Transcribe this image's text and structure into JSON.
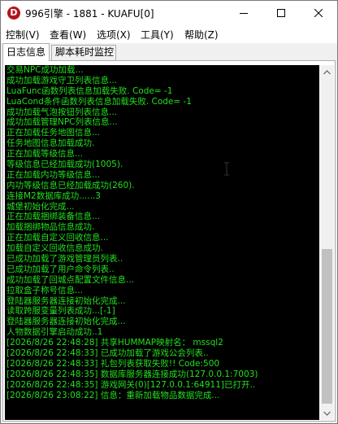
{
  "window": {
    "title": "996引擎 - 1881 - KUAFU[0]",
    "app_icon_glyph": "D",
    "accent_color": "#b3151b"
  },
  "menubar": {
    "items": [
      "控制(V)",
      "查看(W)",
      "选项(X)",
      "工具(Y)",
      "帮助(Z)"
    ]
  },
  "tabs": [
    {
      "label": "日志信息",
      "active": true
    },
    {
      "label": "脚本耗时监控",
      "active": false
    }
  ],
  "log": {
    "text_color": "#22e01e",
    "background_color": "#000000",
    "lines": [
      "交易NPC成功加载...",
      "成功加载游戏守卫列表信息...",
      "LuaFunc函数列表信息加载失败. Code= -1",
      "LuaCond条件函数列表信息加载失败. Code= -1",
      "成功加载气泡按钮列表信息...",
      "成功加载管理NPC列表信息...",
      "正在加载任务地图信息...",
      "任务地图信息加载成功.",
      "正在加载等级信息...",
      "等级信息已经加载成功(1005).",
      "正在加载内功等级信息...",
      "内功等级信息已经加载成功(260).",
      "连接M2数据库成功......3",
      "城堡初始化完成...",
      "正在加载捆绑装备信息...",
      "加载捆绑物品信息成功.",
      "正在加载自定义回收信息...",
      "加载自定义回收信息成功.",
      "已成功加载了游戏管理员列表..",
      "已成功加载了用户命令列表..",
      "成功加载了回城点配置文件信息...",
      "拉取盒子称号信息...",
      "登陆器服务器连接初始化完成...",
      "读取跨服变量列表成功...[-1]",
      "登陆器服务器连接初始化完成...",
      "人物数据引擎启动成功..1",
      "[2026/8/26 22:48:28] 共享HUMMAP映射名： mssql2",
      "[2026/8/26 22:48:33] 已成功加载了游戏公会列表..",
      "[2026/8/26 22:48:33] 礼包列表获取失败!! Code:500",
      "[2026/8/26 22:48:35] 数据库服务器连接成功(127.0.0.1:7003)",
      "[2026/8/26 22:48:35] 游戏网关(0)[127.0.0.1:64911]已打开..",
      "[2026/8/26 23:08:22] 信息：重新加载物品数据完成..."
    ]
  }
}
